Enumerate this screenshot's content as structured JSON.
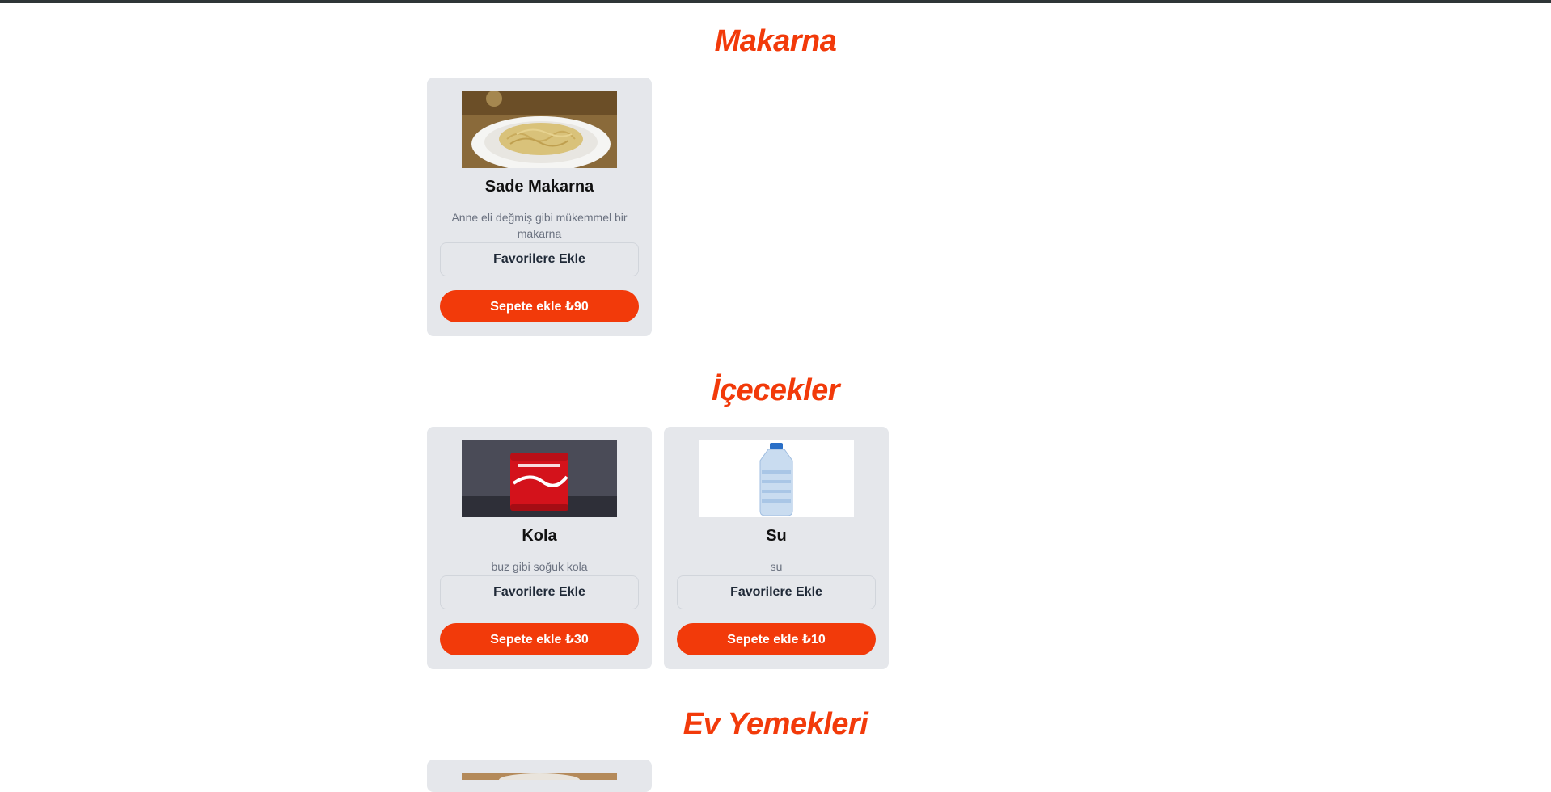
{
  "colors": {
    "accent": "#f23a0a",
    "card_bg": "#e5e7eb",
    "topbar": "#2f3537"
  },
  "sections": [
    {
      "title": "Makarna",
      "items": [
        {
          "name": "Sade Makarna",
          "description": "Anne eli değmiş gibi mükemmel bir makarna",
          "image": "pasta-plate",
          "favorite_label": "Favorilere Ekle",
          "cart_label": "Sepete ekle ₺90"
        }
      ]
    },
    {
      "title": "İçecekler",
      "items": [
        {
          "name": "Kola",
          "description": "buz gibi soğuk kola",
          "image": "cola-can",
          "favorite_label": "Favorilere Ekle",
          "cart_label": "Sepete ekle ₺30"
        },
        {
          "name": "Su",
          "description": "su",
          "image": "water-bottle",
          "favorite_label": "Favorilere Ekle",
          "cart_label": "Sepete ekle ₺10"
        }
      ]
    },
    {
      "title": "Ev Yemekleri",
      "items": [
        {
          "image": "home-meal"
        }
      ]
    }
  ]
}
